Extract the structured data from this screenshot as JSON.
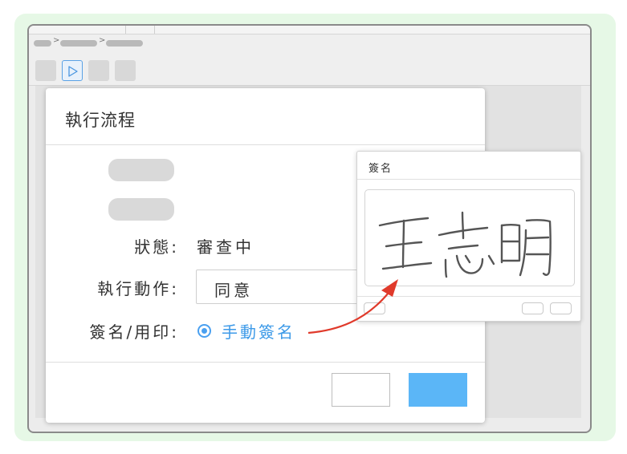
{
  "dialog": {
    "title": "執行流程",
    "fields": {
      "status_label": "狀態:",
      "status_value": "審查中",
      "action_label": "執行動作:",
      "action_value": "同意",
      "signature_label": "簽名/用印:",
      "signature_option": "手動簽名"
    }
  },
  "signature_panel": {
    "title": "簽名"
  },
  "colors": {
    "accent": "#4aa0f0",
    "primary_button": "#5bb6f7",
    "arrow": "#e03a2b",
    "outer_background": "#e6f8e6"
  },
  "icons": {
    "toolbar_active": "play-outline-icon"
  }
}
